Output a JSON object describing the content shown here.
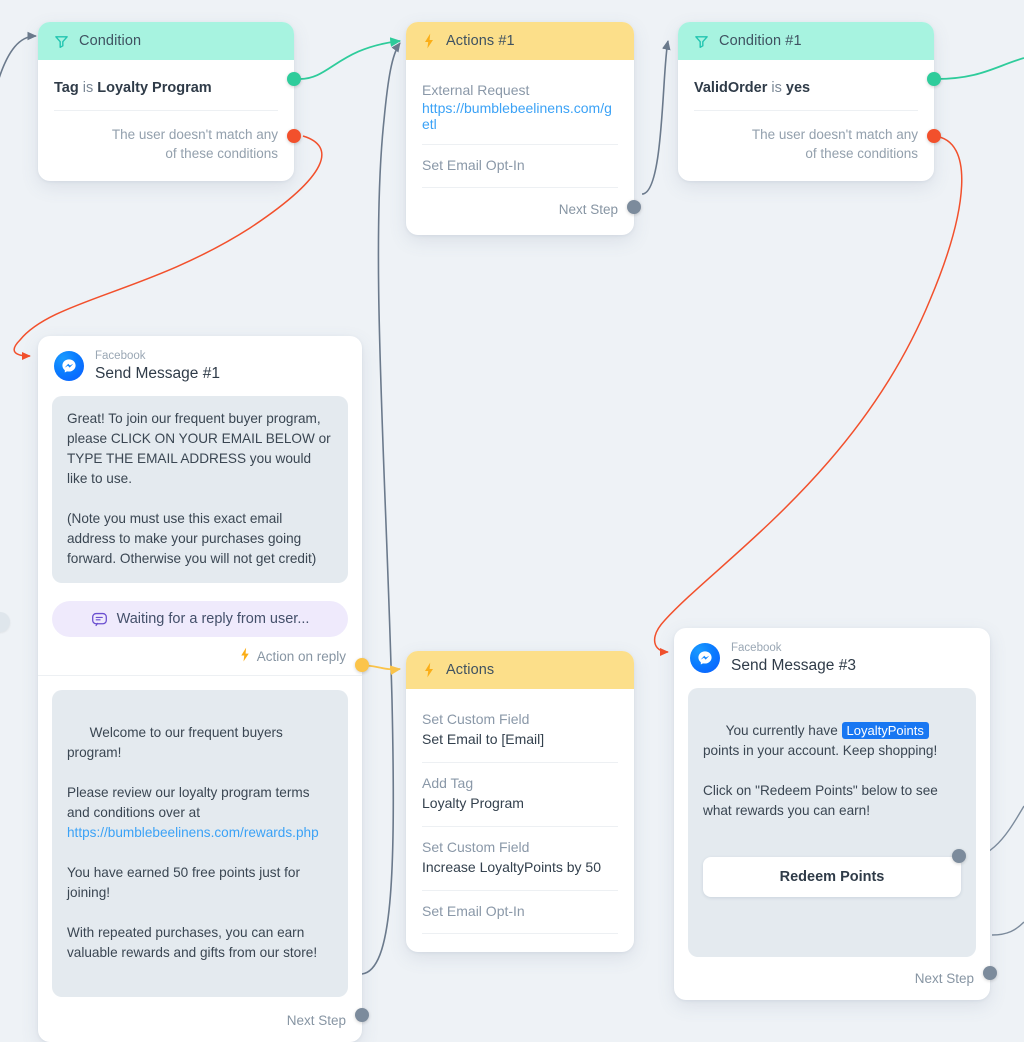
{
  "canvas": {
    "background": "#eef2f6"
  },
  "palette": {
    "condition_header": "#a7f3e0",
    "actions_header": "#fcdf8a",
    "port_green": "#2ecc9b",
    "port_red": "#f2502c",
    "port_gray": "#7c8b9c",
    "port_yellow": "#fbc44a",
    "link_blue": "#3ba2f6",
    "token_blue": "#1877f2",
    "edge_gray": "#7c8b9c",
    "edge_green": "#2ecc9b",
    "edge_red": "#f2502c"
  },
  "nodes": {
    "condition": {
      "title": "Condition",
      "icon": "filter-icon",
      "condition_key": "Tag",
      "condition_op": "is",
      "condition_value": "Loyalty Program",
      "no_match_line1": "The user doesn't match any",
      "no_match_line2": "of these conditions"
    },
    "actions1": {
      "title": "Actions #1",
      "icon": "lightning-icon",
      "rows": [
        {
          "label": "External Request",
          "value": "https://bumblebeelinens.com/getl",
          "is_link": true
        },
        {
          "label": "Set Email Opt-In",
          "value": "",
          "is_link": false
        }
      ],
      "next_step": "Next Step"
    },
    "condition1": {
      "title": "Condition #1",
      "icon": "filter-icon",
      "condition_key": "ValidOrder",
      "condition_op": "is",
      "condition_value": "yes",
      "no_match_line1": "The user doesn't match any",
      "no_match_line2": "of these conditions"
    },
    "send_message_1": {
      "channel": "Facebook",
      "title": "Send Message #1",
      "icon": "messenger-icon",
      "bubble_1": "Great! To join our frequent buyer program, please CLICK ON YOUR EMAIL BELOW or TYPE THE EMAIL ADDRESS you would like to use.\n\n(Note you must use this exact email address to make your purchases going forward. Otherwise you will not get credit)",
      "waiting_label": "Waiting for a reply from user...",
      "waiting_icon": "chat-bubble-icon",
      "action_on_reply": "Action on reply",
      "action_on_reply_icon": "lightning-icon",
      "bubble_2_part1": "Welcome to our frequent buyers program!\n\nPlease review our loyalty program terms and conditions over at\n",
      "bubble_2_link": "https://bumblebeelinens.com/rewards.php",
      "bubble_2_part2": "\n\nYou have earned 50 free points just for joining!\n\nWith repeated purchases, you can earn valuable rewards and gifts from our store!",
      "next_step": "Next Step"
    },
    "actions2": {
      "title": "Actions",
      "icon": "lightning-icon",
      "rows": [
        {
          "label": "Set Custom Field",
          "value": "Set Email to [Email]"
        },
        {
          "label": "Add Tag",
          "value": "Loyalty Program"
        },
        {
          "label": "Set Custom Field",
          "value": "Increase LoyaltyPoints by 50"
        },
        {
          "label": "Set Email Opt-In",
          "value": ""
        }
      ]
    },
    "send_message_3": {
      "channel": "Facebook",
      "title": "Send Message #3",
      "icon": "messenger-icon",
      "bubble_part1": "You currently have ",
      "bubble_token": "LoyaltyPoints",
      "bubble_part2": " points in your account. Keep shopping!\n\nClick on \"Redeem Points\" below to see what rewards you can earn!",
      "cta_label": "Redeem Points",
      "next_step": "Next Step"
    }
  }
}
